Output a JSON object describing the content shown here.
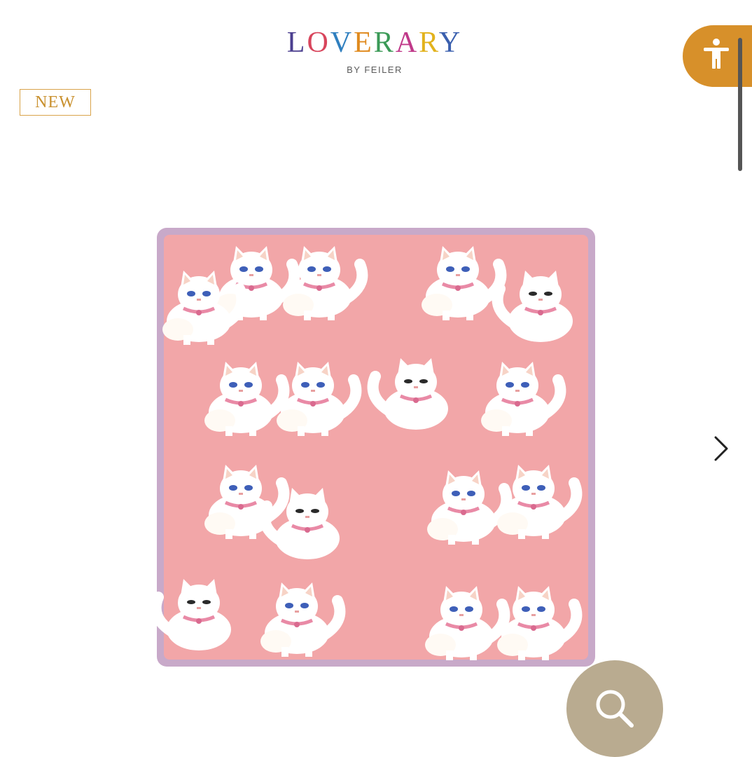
{
  "brand": {
    "letters": [
      {
        "ch": "L",
        "color": "#4b3f8f"
      },
      {
        "ch": "O",
        "color": "#d8455c"
      },
      {
        "ch": "V",
        "color": "#2f7fbf"
      },
      {
        "ch": "E",
        "color": "#e08a1e"
      },
      {
        "ch": "R",
        "color": "#3b9a57"
      },
      {
        "ch": "A",
        "color": "#c03a8a"
      },
      {
        "ch": "R",
        "color": "#e2b21c"
      },
      {
        "ch": "Y",
        "color": "#3a5fae"
      }
    ],
    "subtitle": "BY FEILER"
  },
  "badge": {
    "label": "NEW",
    "color": "#d9a34a"
  },
  "accessibility": {
    "icon": "accessibility-person-icon",
    "color": "#d7902a"
  },
  "carousel": {
    "next_icon": "chevron-right-icon",
    "product_image": {
      "description_icon": "towel-cats-pattern",
      "background": "#f2a6a8",
      "border": "#c8a9c9"
    }
  },
  "zoom": {
    "icon": "search-icon",
    "color": "#b9ab90"
  }
}
